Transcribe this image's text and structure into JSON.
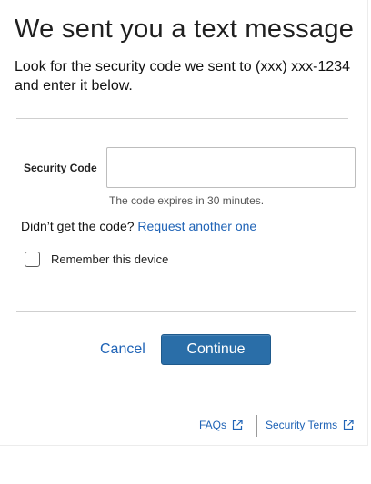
{
  "header": {
    "title": "We sent you a text message",
    "subtitle": "Look for the security code we sent to (xxx) xxx-1234 and enter it below."
  },
  "form": {
    "code_label": "Security Code",
    "code_value": "",
    "code_hint": "The code expires in 30 minutes.",
    "resend_prompt": "Didn’t get the code?",
    "resend_link": "Request another one",
    "remember_label": "Remember this device",
    "remember_checked": false
  },
  "actions": {
    "cancel_label": "Cancel",
    "continue_label": "Continue"
  },
  "footer": {
    "faqs_label": "FAQs",
    "terms_label": "Security Terms"
  },
  "colors": {
    "link": "#1f63b6",
    "primary_button": "#2a6ea8"
  },
  "icons": {
    "faqs": "external-link-icon",
    "terms": "external-link-icon"
  }
}
